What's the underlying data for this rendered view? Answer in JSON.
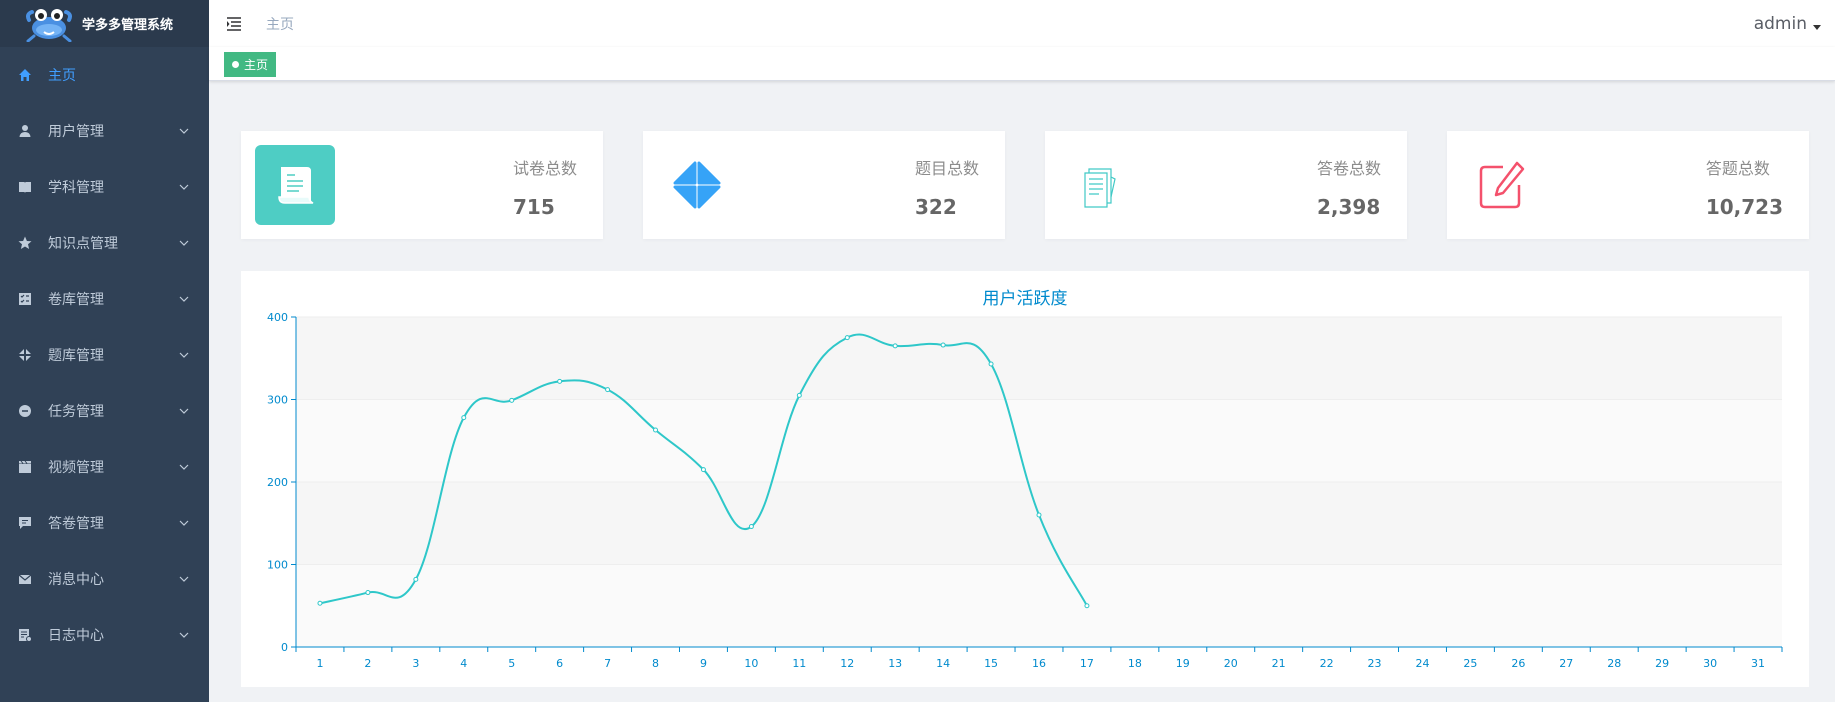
{
  "app": {
    "title": "学多多管理系统"
  },
  "sidebar": {
    "items": [
      {
        "label": "主页",
        "icon": "home-icon",
        "active": true,
        "expandable": false
      },
      {
        "label": "用户管理",
        "icon": "user-icon",
        "active": false,
        "expandable": true
      },
      {
        "label": "学科管理",
        "icon": "book-icon",
        "active": false,
        "expandable": true
      },
      {
        "label": "知识点管理",
        "icon": "star-icon",
        "active": false,
        "expandable": true
      },
      {
        "label": "卷库管理",
        "icon": "checklist-icon",
        "active": false,
        "expandable": true
      },
      {
        "label": "题库管理",
        "icon": "pinwheel-icon",
        "active": false,
        "expandable": true
      },
      {
        "label": "任务管理",
        "icon": "circle-icon",
        "active": false,
        "expandable": true
      },
      {
        "label": "视频管理",
        "icon": "clapper-icon",
        "active": false,
        "expandable": true
      },
      {
        "label": "答卷管理",
        "icon": "message-icon",
        "active": false,
        "expandable": true
      },
      {
        "label": "消息中心",
        "icon": "mail-icon",
        "active": false,
        "expandable": true
      },
      {
        "label": "日志中心",
        "icon": "log-icon",
        "active": false,
        "expandable": true
      }
    ]
  },
  "header": {
    "breadcrumb": "主页",
    "user": "admin"
  },
  "tags": {
    "active": "主页"
  },
  "cards": [
    {
      "title": "试卷总数",
      "value": "715",
      "icon": "scroll-icon",
      "color": "#4ecdc4"
    },
    {
      "title": "题目总数",
      "value": "322",
      "icon": "pinwheel-icon",
      "color": "#36a3f7"
    },
    {
      "title": "答卷总数",
      "value": "2,398",
      "icon": "documents-icon",
      "color": "#40c9c6"
    },
    {
      "title": "答题总数",
      "value": "10,723",
      "icon": "edit-icon",
      "color": "#f4516c"
    }
  ],
  "colors": {
    "sidebar": "#304156",
    "accent": "#409eff",
    "tag": "#42b983",
    "line": "#2ec7c9",
    "axis": "#008acd"
  },
  "chart_data": {
    "type": "line",
    "title": "用户活跃度",
    "x": [
      "1",
      "2",
      "3",
      "4",
      "5",
      "6",
      "7",
      "8",
      "9",
      "10",
      "11",
      "12",
      "13",
      "14",
      "15",
      "16",
      "17",
      "18",
      "19",
      "20",
      "21",
      "22",
      "23",
      "24",
      "25",
      "26",
      "27",
      "28",
      "29",
      "30",
      "31"
    ],
    "y": [
      53,
      66,
      82,
      278,
      299,
      322,
      312,
      263,
      215,
      146,
      305,
      375,
      365,
      366,
      343,
      160,
      50
    ],
    "ylim": [
      0,
      400
    ],
    "yticks": [
      0,
      100,
      200,
      300,
      400
    ],
    "smooth": true,
    "grid": true
  }
}
